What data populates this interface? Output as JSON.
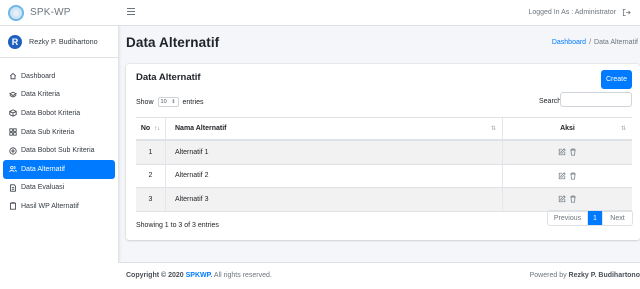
{
  "brand": {
    "name": "SPK-WP"
  },
  "user": {
    "initial": "R",
    "name": "Rezky P. Budihartono"
  },
  "sidebar": {
    "items": [
      {
        "label": "Dashboard",
        "icon": "home-icon",
        "active": false
      },
      {
        "label": "Data Kriteria",
        "icon": "layers-icon",
        "active": false
      },
      {
        "label": "Data Bobot Kriteria",
        "icon": "box-icon",
        "active": false
      },
      {
        "label": "Data Sub Kriteria",
        "icon": "grid-icon",
        "active": false
      },
      {
        "label": "Data Bobot Sub Kriteria",
        "icon": "disc-icon",
        "active": false
      },
      {
        "label": "Data Alternatif",
        "icon": "users-icon",
        "active": true
      },
      {
        "label": "Data Evaluasi",
        "icon": "file-icon",
        "active": false
      },
      {
        "label": "Hasil WP Alternatif",
        "icon": "clipboard-icon",
        "active": false
      }
    ]
  },
  "topbar": {
    "logged_in": "Logged In As : Administrator"
  },
  "page": {
    "title": "Data Alternatif",
    "breadcrumb": {
      "home": "Dashboard",
      "separator": "/",
      "current": "Data Alternatif"
    }
  },
  "card": {
    "title": "Data Alternatif",
    "create_label": "Create",
    "show_label": "Show",
    "entries_value": "10",
    "entries_label": "entries",
    "search_label": "Search:",
    "search_placeholder": ""
  },
  "table": {
    "headers": {
      "no": "No",
      "name": "Nama Alternatif",
      "aksi": "Aksi"
    },
    "rows": [
      {
        "no": "1",
        "name": "Alternatif 1"
      },
      {
        "no": "2",
        "name": "Alternatif 2"
      },
      {
        "no": "3",
        "name": "Alternatif 3"
      }
    ]
  },
  "pagination": {
    "info": "Showing 1 to 3 of 3 entries",
    "prev": "Previous",
    "current": "1",
    "next": "Next"
  },
  "footer": {
    "copyright_prefix": "Copyright © 2020",
    "copyright_brand": "SPKWP.",
    "copyright_suffix": "All rights reserved.",
    "powered_prefix": "Powered by",
    "powered_name": "Rezky P. Budihartono"
  },
  "colors": {
    "primary": "#007bff",
    "sidebar_bg": "#ffffff",
    "content_bg": "#f4f6f9"
  }
}
